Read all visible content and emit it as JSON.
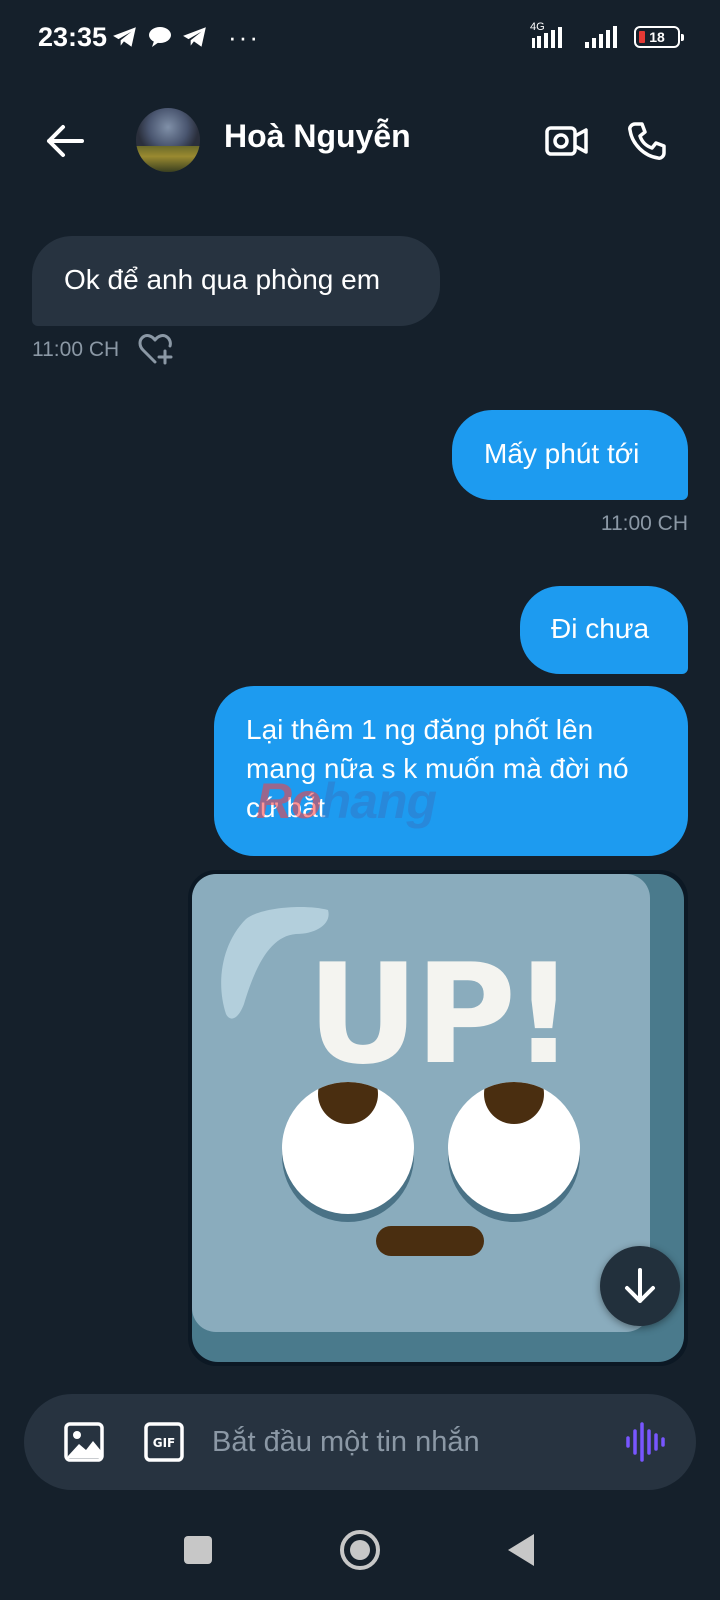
{
  "status_bar": {
    "time": "23:35",
    "network": "4G",
    "battery": "18",
    "more": "···"
  },
  "header": {
    "contact_name": "Hoà Nguyễn"
  },
  "messages": [
    {
      "direction": "incoming",
      "text": "Ok để anh qua phòng em",
      "time": "11:00 CH"
    },
    {
      "direction": "outgoing",
      "text": "Mấy phút tới",
      "time": "11:00 CH"
    },
    {
      "direction": "outgoing",
      "text": "Đi chưa"
    },
    {
      "direction": "outgoing",
      "text": "Lại thêm 1 ng đăng phốt lên mang nữa s k muốn mà đời nó cứ bắt"
    },
    {
      "direction": "outgoing",
      "type": "sticker",
      "sticker_text": "UP!"
    }
  ],
  "watermark": {
    "part1": "Ro",
    "part2": "hang"
  },
  "composer": {
    "placeholder": "Bắt đầu một tin nhắn"
  },
  "colors": {
    "background": "#15202b",
    "incoming_bubble": "#273340",
    "outgoing_bubble": "#1d9bf0",
    "muted_text": "#8b98a5"
  },
  "icons": {
    "back": "arrow-left-icon",
    "video": "video-camera-icon",
    "call": "phone-icon",
    "heart_add": "heart-plus-icon",
    "media": "image-icon",
    "gif": "gif-icon",
    "voice": "audio-wave-icon",
    "scroll_down": "arrow-down-icon"
  }
}
